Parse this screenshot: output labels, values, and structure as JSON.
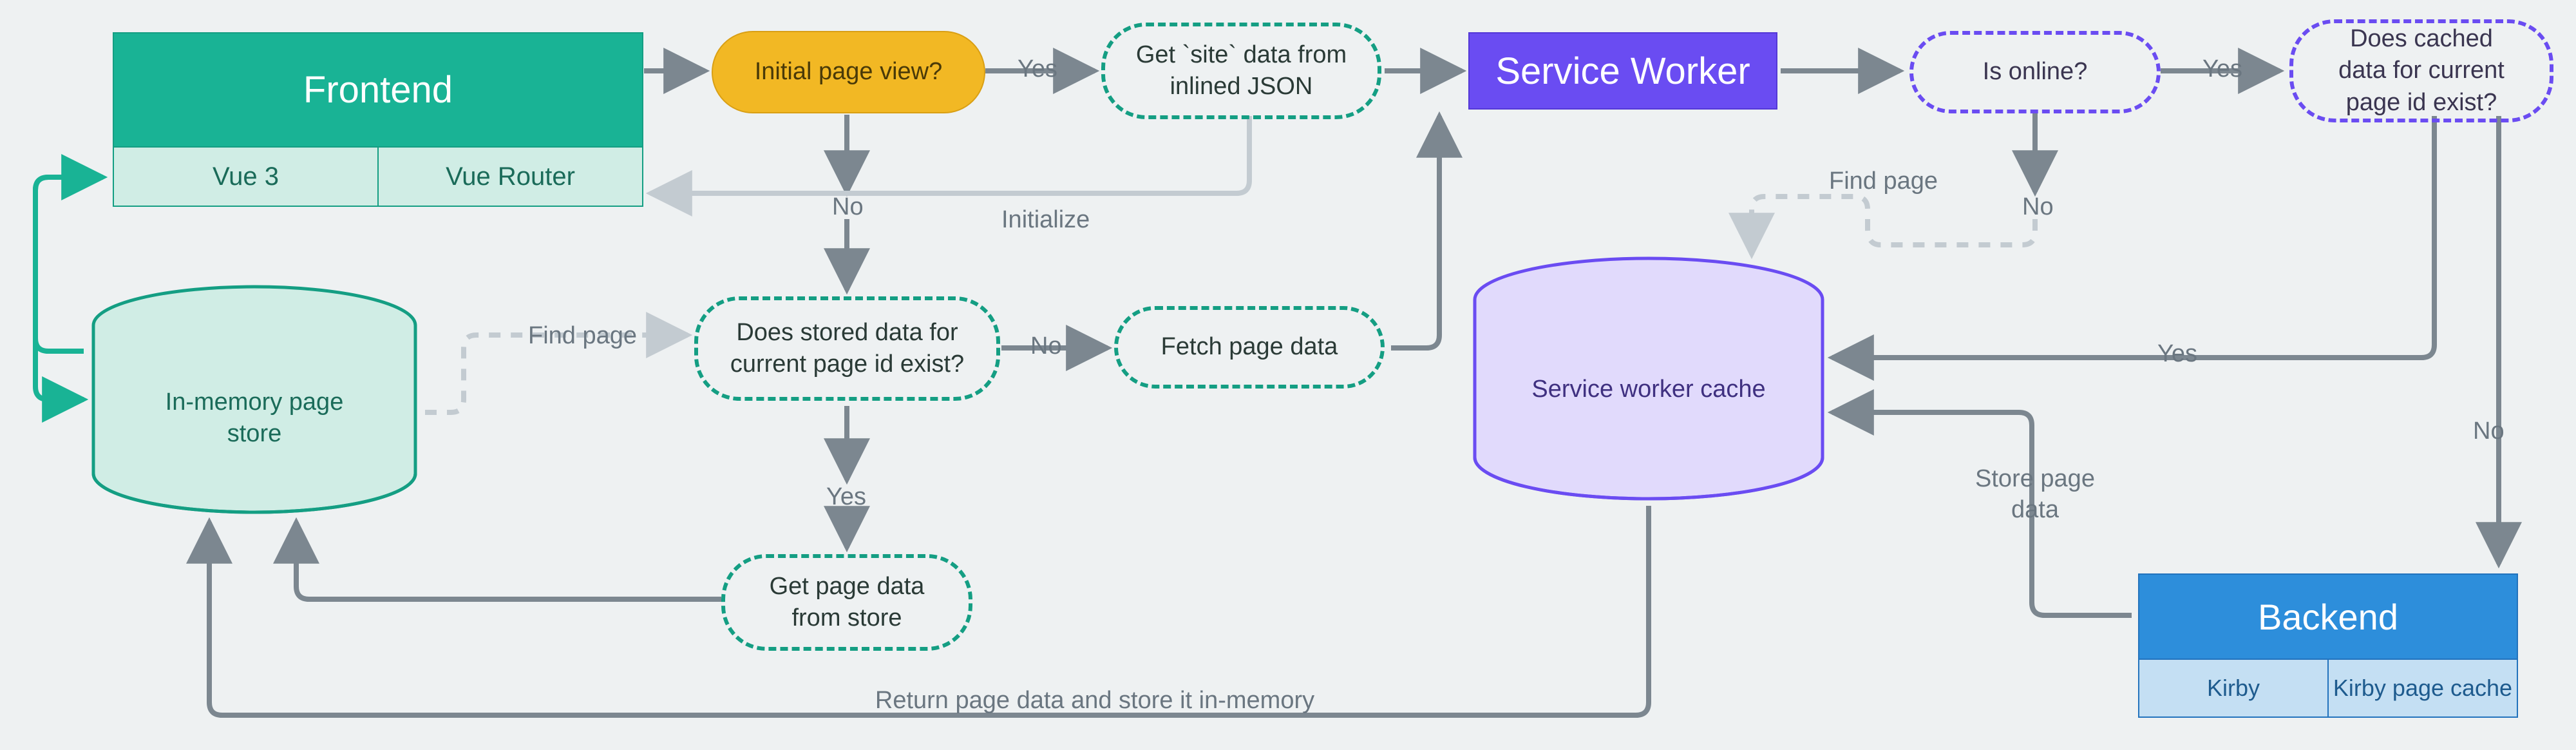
{
  "frontend": {
    "title": "Frontend",
    "tech1": "Vue 3",
    "tech2": "Vue Router",
    "color_fill": "#19b395",
    "color_light": "#d0ede5",
    "color_border": "#149e83",
    "title_color": "#ffffff"
  },
  "service_worker": {
    "title": "Service Worker",
    "color_fill": "#6a4cf2",
    "color_border": "#5438d6",
    "title_color": "#ffffff"
  },
  "backend": {
    "title": "Backend",
    "tech1": "Kirby",
    "tech2": "Kirby page cache",
    "color_fill": "#2d8edb",
    "color_light": "#c4dff3",
    "color_border": "#2273bd",
    "title_color": "#ffffff"
  },
  "nodes": {
    "initial_page_view": "Initial page view?",
    "get_site_data": "Get `site` data from inlined JSON",
    "does_stored_exist": "Does stored data for current page id exist?",
    "fetch_page_data": "Fetch page data",
    "get_page_data_store": "Get page data from store",
    "is_online": "Is online?",
    "does_cached_exist": "Does cached data for current page id exist?"
  },
  "cylinders": {
    "in_memory_store": "In-memory page store",
    "sw_cache": "Service worker cache"
  },
  "labels": {
    "yes": "Yes",
    "no": "No",
    "initialize": "Initialize",
    "find_page": "Find page",
    "store_page_data": "Store page data",
    "return_store": "Return page data and store it in-memory"
  },
  "colors": {
    "arrow_grey": "#7c8790",
    "arrow_light": "#c3cbd1",
    "green_dash": "#149e83",
    "purple_dash": "#6a4cf2",
    "yellow_fill": "#f2b824",
    "yellow_border": "#d99f14"
  }
}
